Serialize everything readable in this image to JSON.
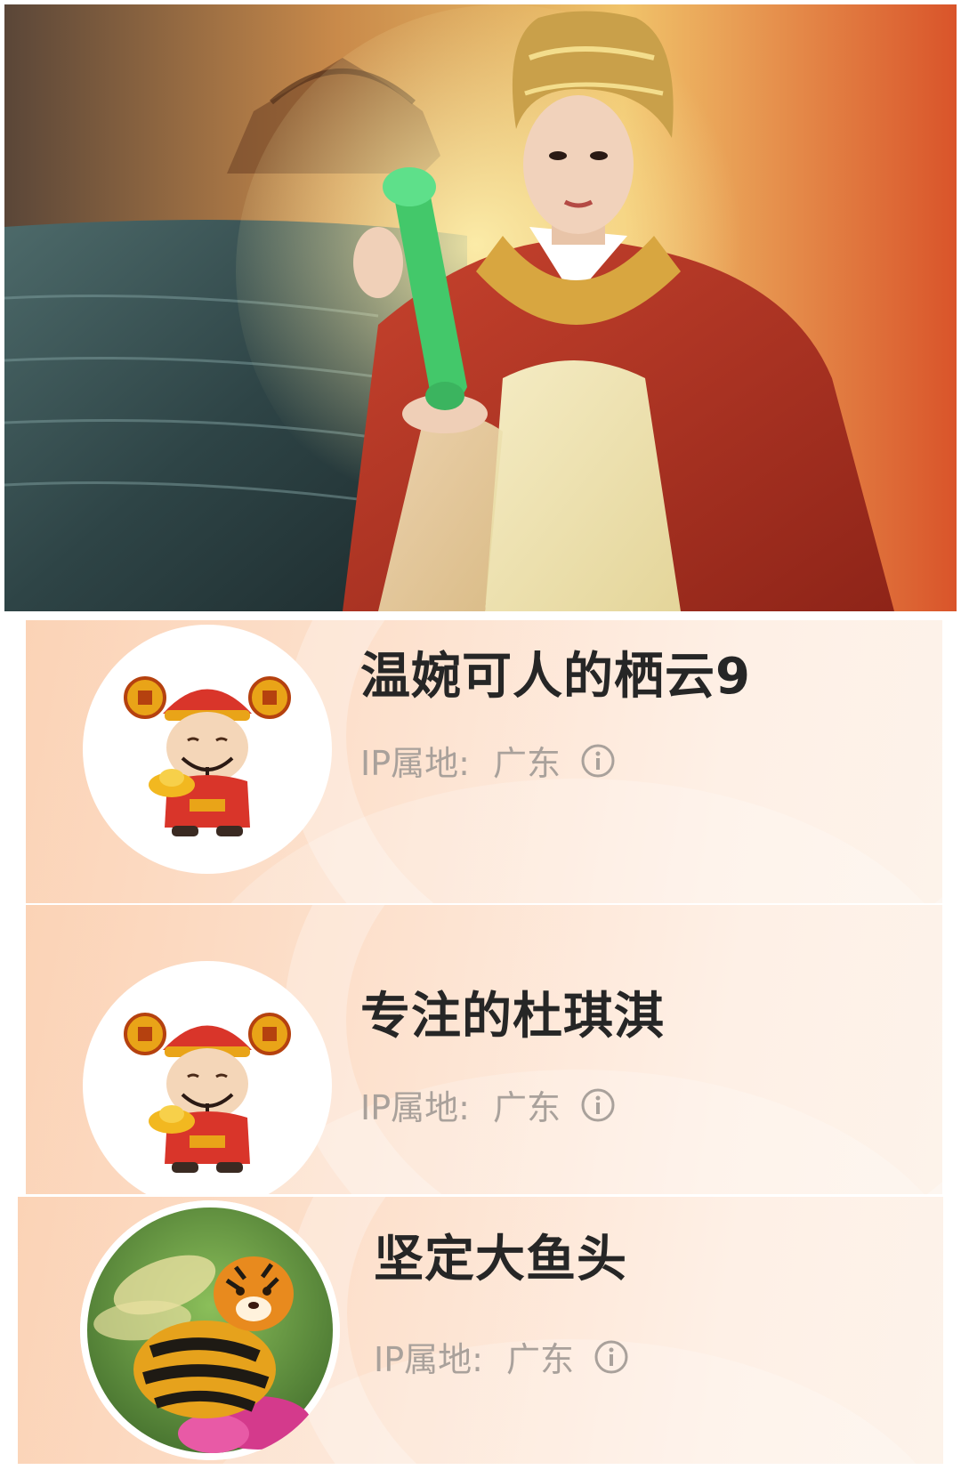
{
  "banner": {
    "description_icon": "goddess-banner-image"
  },
  "profiles": [
    {
      "username": "温婉可人的栖云9",
      "ip_label": "IP属地:",
      "ip_value": "广东",
      "avatar": "god-of-wealth-avatar"
    },
    {
      "username": "专注的杜琪淇",
      "ip_label": "IP属地:",
      "ip_value": "广东",
      "avatar": "god-of-wealth-avatar"
    },
    {
      "username": "坚定大鱼头",
      "ip_label": "IP属地:",
      "ip_value": "广东",
      "avatar": "tiger-bee-avatar"
    }
  ],
  "colors": {
    "card_gradient_start": "#fbd3b6",
    "card_gradient_end": "#fdf3ea",
    "username": "#262626",
    "ip_text": "#a9a19b"
  }
}
